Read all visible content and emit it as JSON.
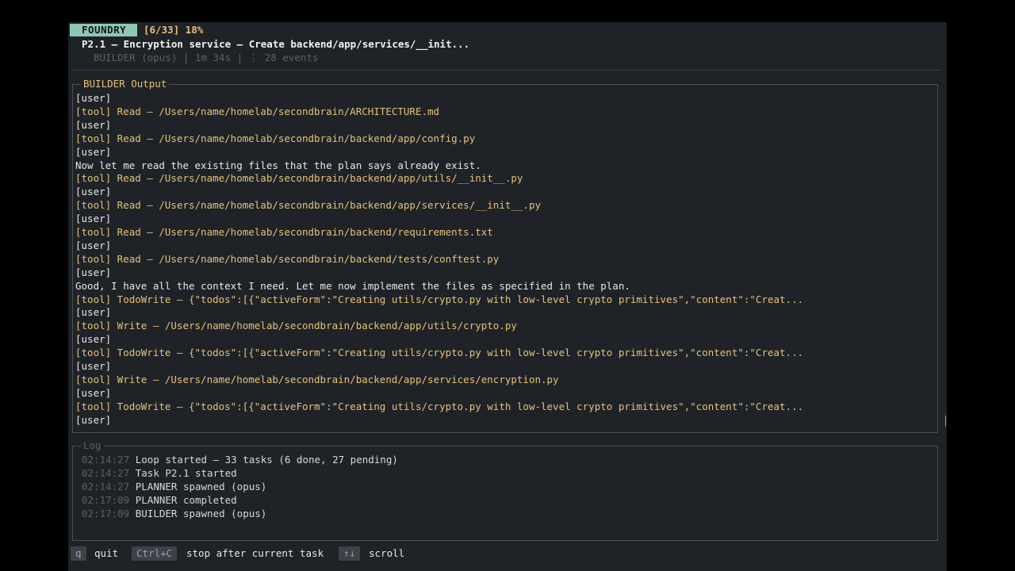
{
  "header": {
    "app_badge": "FOUNDRY",
    "progress": "[6/33] 18%",
    "task_title": "P2.1 – Encryption service – Create backend/app/services/__init...",
    "task_meta": "BUILDER (opus) | 1m 34s | ⋮ 28 events"
  },
  "builder_panel": {
    "title": "BUILDER Output",
    "lines": [
      {
        "kind": "user",
        "text": "[user]"
      },
      {
        "kind": "tool",
        "text": "[tool] Read – /Users/name/homelab/secondbrain/ARCHITECTURE.md"
      },
      {
        "kind": "user",
        "text": "[user]"
      },
      {
        "kind": "tool",
        "text": "[tool] Read – /Users/name/homelab/secondbrain/backend/app/config.py"
      },
      {
        "kind": "user",
        "text": "[user]"
      },
      {
        "kind": "text",
        "text": "Now let me read the existing files that the plan says already exist."
      },
      {
        "kind": "tool",
        "text": "[tool] Read – /Users/name/homelab/secondbrain/backend/app/utils/__init__.py"
      },
      {
        "kind": "user",
        "text": "[user]"
      },
      {
        "kind": "tool",
        "text": "[tool] Read – /Users/name/homelab/secondbrain/backend/app/services/__init__.py"
      },
      {
        "kind": "user",
        "text": "[user]"
      },
      {
        "kind": "tool",
        "text": "[tool] Read – /Users/name/homelab/secondbrain/backend/requirements.txt"
      },
      {
        "kind": "user",
        "text": "[user]"
      },
      {
        "kind": "tool",
        "text": "[tool] Read – /Users/name/homelab/secondbrain/backend/tests/conftest.py"
      },
      {
        "kind": "user",
        "text": "[user]"
      },
      {
        "kind": "text",
        "text": "Good, I have all the context I need. Let me now implement the files as specified in the plan."
      },
      {
        "kind": "tool",
        "text": "[tool] TodoWrite – {\"todos\":[{\"activeForm\":\"Creating utils/crypto.py with low-level crypto primitives\",\"content\":\"Creat..."
      },
      {
        "kind": "user",
        "text": "[user]"
      },
      {
        "kind": "tool",
        "text": "[tool] Write – /Users/name/homelab/secondbrain/backend/app/utils/crypto.py"
      },
      {
        "kind": "user",
        "text": "[user]"
      },
      {
        "kind": "tool",
        "text": "[tool] TodoWrite – {\"todos\":[{\"activeForm\":\"Creating utils/crypto.py with low-level crypto primitives\",\"content\":\"Creat..."
      },
      {
        "kind": "user",
        "text": "[user]"
      },
      {
        "kind": "tool",
        "text": "[tool] Write – /Users/name/homelab/secondbrain/backend/app/services/encryption.py"
      },
      {
        "kind": "user",
        "text": "[user]"
      },
      {
        "kind": "tool",
        "text": "[tool] TodoWrite – {\"todos\":[{\"activeForm\":\"Creating utils/crypto.py with low-level crypto primitives\",\"content\":\"Creat..."
      },
      {
        "kind": "user",
        "text": "[user]"
      }
    ]
  },
  "log_panel": {
    "title": "Log",
    "entries": [
      {
        "time": "02:14:27",
        "message": "Loop started – 33 tasks (6 done, 27 pending)"
      },
      {
        "time": "02:14:27",
        "message": "Task P2.1 started"
      },
      {
        "time": "02:14:27",
        "message": "PLANNER spawned (opus)"
      },
      {
        "time": "02:17:09",
        "message": "PLANNER completed"
      },
      {
        "time": "02:17:09",
        "message": "BUILDER spawned (opus)"
      }
    ]
  },
  "footer": {
    "keys": [
      {
        "key": "q",
        "label": "quit"
      },
      {
        "key": "Ctrl+C",
        "label": "stop after current task"
      },
      {
        "key": "↑↓",
        "label": "scroll"
      }
    ]
  },
  "colors": {
    "badge": "#8fc7b4",
    "accent": "#e5c07b",
    "background": "#1f2327",
    "muted": "#5a6068"
  }
}
